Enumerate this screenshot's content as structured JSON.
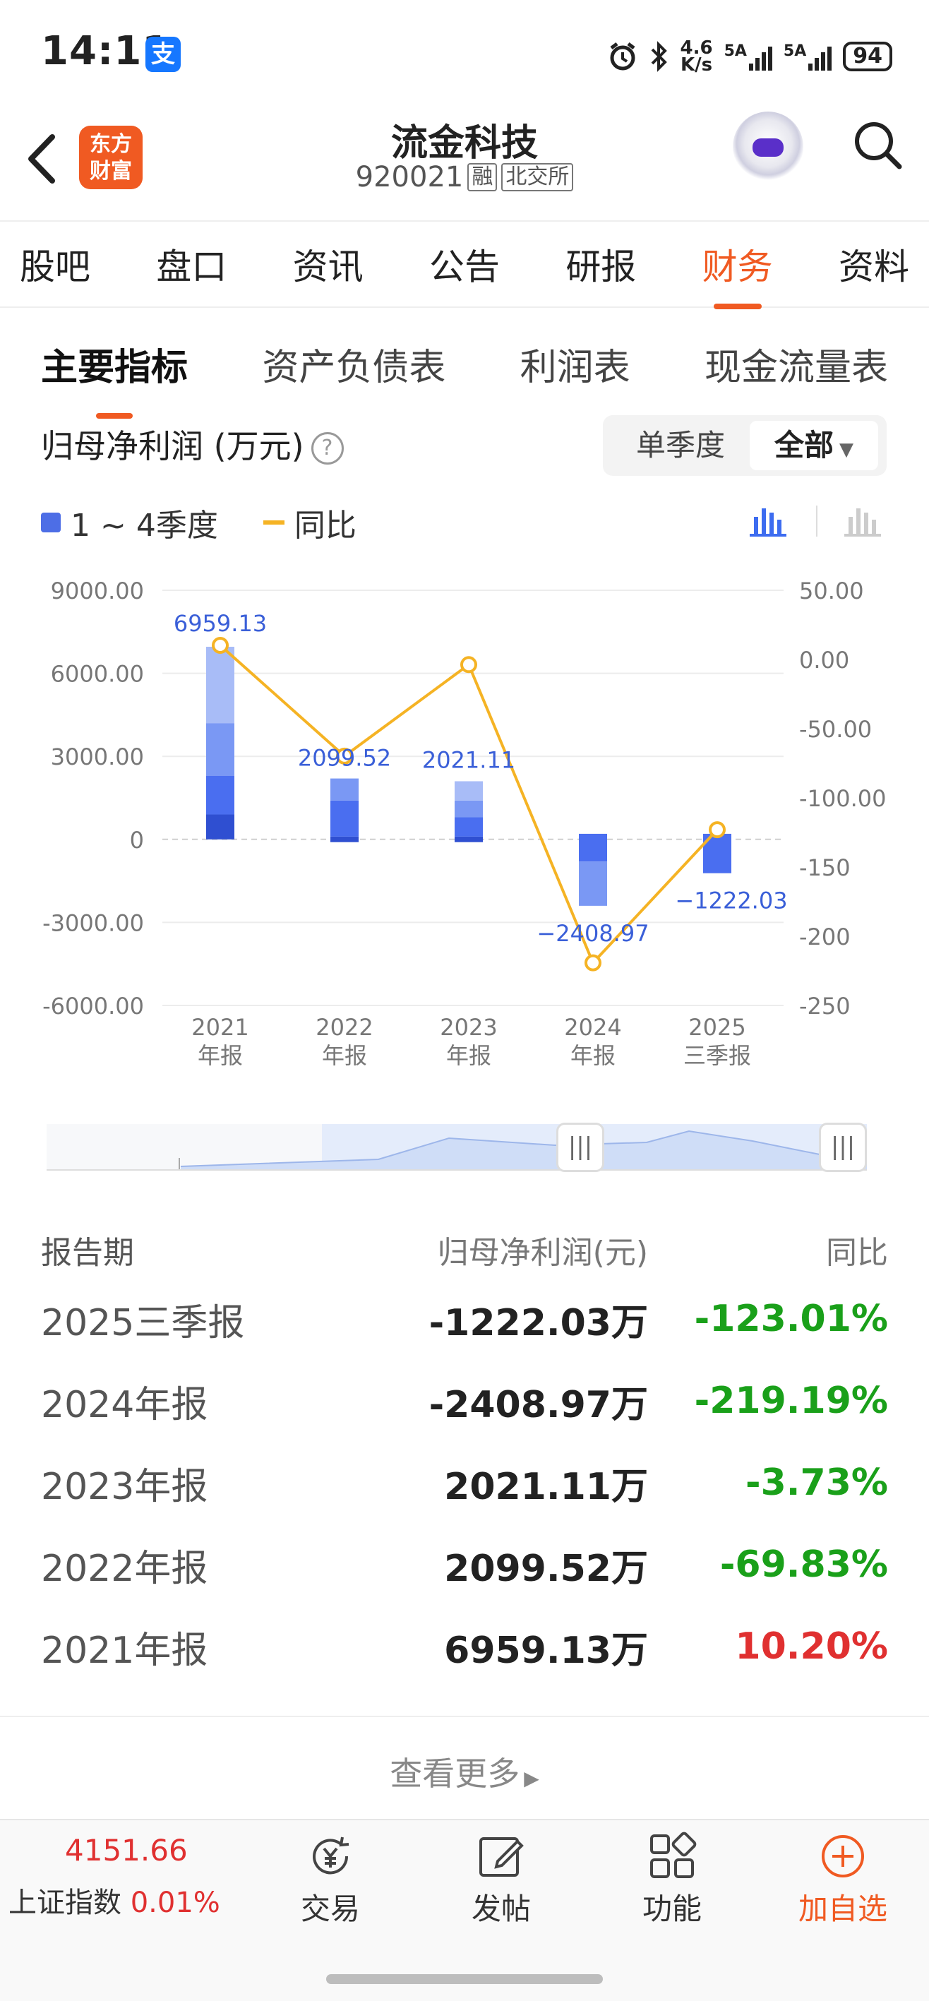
{
  "status_bar": {
    "time": "14:11",
    "alipay_icon": "支",
    "net_speed_top": "4.6",
    "net_speed_bottom": "K/s",
    "sig1": "5A",
    "sig2": "5A",
    "battery": "94"
  },
  "header": {
    "logo_line1": "东方",
    "logo_line2": "财富",
    "title": "流金科技",
    "code": "920021",
    "tag1": "融",
    "tag2": "北交所"
  },
  "main_tabs": [
    "股吧",
    "盘口",
    "资讯",
    "公告",
    "研报",
    "财务",
    "资料"
  ],
  "main_tab_active": 5,
  "sub_tabs": [
    "主要指标",
    "资产负债表",
    "利润表",
    "现金流量表"
  ],
  "chart_header": {
    "title": "归母净利润 (万元)",
    "help": "?",
    "period_single": "单季度",
    "period_all": "全部"
  },
  "legend": {
    "bars": "1 ~ 4季度",
    "line": "同比"
  },
  "colors": {
    "accent": "#f05a22",
    "bar": "#4d6ee6",
    "line": "#f5b324",
    "down": "#1aa01a",
    "up": "#e03030"
  },
  "chart_data": {
    "type": "bar",
    "categories": [
      "2021\n年报",
      "2022\n年报",
      "2023\n年报",
      "2024\n年报",
      "2025\n三季报"
    ],
    "category_lines": [
      [
        "2021",
        "年报"
      ],
      [
        "2022",
        "年报"
      ],
      [
        "2023",
        "年报"
      ],
      [
        "2024",
        "年报"
      ],
      [
        "2025",
        "三季报"
      ]
    ],
    "values": [
      6959.13,
      2099.52,
      2021.11,
      -2408.97,
      -1222.03
    ],
    "value_labels": [
      "6959.13",
      "2099.52",
      "2021.11",
      "−2408.97",
      "−1222.03"
    ],
    "quarter_stacks": [
      [
        [
          0,
          900
        ],
        [
          900,
          2300
        ],
        [
          2300,
          4200
        ],
        [
          4200,
          6959
        ]
      ],
      [
        [
          -100,
          100
        ],
        [
          100,
          1400
        ],
        [
          1400,
          2200
        ]
      ],
      [
        [
          -100,
          100
        ],
        [
          100,
          800
        ],
        [
          800,
          1400
        ],
        [
          1400,
          2100
        ]
      ],
      [
        [
          0,
          200
        ],
        [
          200,
          -800
        ],
        [
          -800,
          -2400
        ]
      ],
      [
        [
          0,
          200
        ],
        [
          200,
          -1222
        ]
      ]
    ],
    "yoy": [
      10.2,
      -69.83,
      -3.73,
      -219.19,
      -123.01
    ],
    "ylim_left": [
      -6000,
      9000
    ],
    "yticks_left": [
      "9000.00",
      "6000.00",
      "3000.00",
      "0",
      "-3000.00",
      "-6000.00"
    ],
    "ylim_right": [
      -250,
      50
    ],
    "yticks_right": [
      "50.00",
      "0.00",
      "-50.00",
      "-100.00",
      "-150",
      "-200",
      "-250"
    ],
    "grid": true
  },
  "range_handles": [
    "|||",
    "|||"
  ],
  "table": {
    "headers": [
      "报告期",
      "归母净利润(元)",
      "同比"
    ],
    "rows": [
      {
        "period": "2025三季报",
        "profit": "-1222.03万",
        "yoy": "-123.01%"
      },
      {
        "period": "2024年报",
        "profit": "-2408.97万",
        "yoy": "-219.19%"
      },
      {
        "period": "2023年报",
        "profit": "2021.11万",
        "yoy": "-3.73%"
      },
      {
        "period": "2022年报",
        "profit": "2099.52万",
        "yoy": "-69.83%"
      },
      {
        "period": "2021年报",
        "profit": "6959.13万",
        "yoy": "10.20%"
      }
    ]
  },
  "more": "查看更多",
  "bottom_bar": {
    "index_value": "4151.66",
    "index_name": "上证指数",
    "index_change": "0.01%",
    "trade": "交易",
    "post": "发帖",
    "func": "功能",
    "add": "加自选"
  }
}
